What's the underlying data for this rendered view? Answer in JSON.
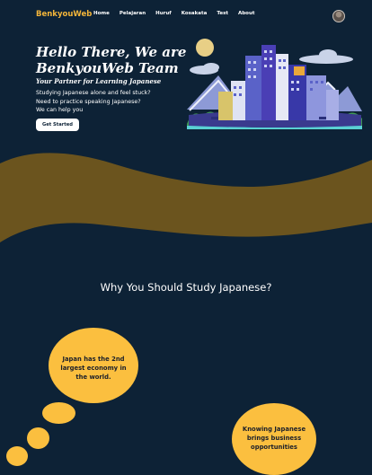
{
  "header": {
    "brand": "BenkyouWeb",
    "links": [
      "Home",
      "Pelajaran",
      "Huruf",
      "Kosakata",
      "Test",
      "About"
    ]
  },
  "hero": {
    "title_line1": "Hello There, We are",
    "title_line2": "BenkyouWeb Team",
    "subtitle": "Your Partner for Learning Japanese",
    "lines": [
      "Studying Japanese alone and feel stuck?",
      "Need to practice speaking Japanese?",
      "We can help you"
    ],
    "cta_label": "Get Started"
  },
  "section": {
    "title": "Why You Should Study Japanese?"
  },
  "bubbles": {
    "first": [
      "Japan has the 2nd",
      "largest economy in",
      "the world."
    ],
    "second": [
      "Knowing Japanese",
      "brings business",
      "opportunities"
    ]
  },
  "colors": {
    "background": "#0d2236",
    "brand": "#f3b53a",
    "wave": "#6b541e",
    "bubble": "#fbbf3f"
  },
  "icons": {
    "avatar": "user-avatar",
    "illustration": "city-skyline-illustration"
  }
}
